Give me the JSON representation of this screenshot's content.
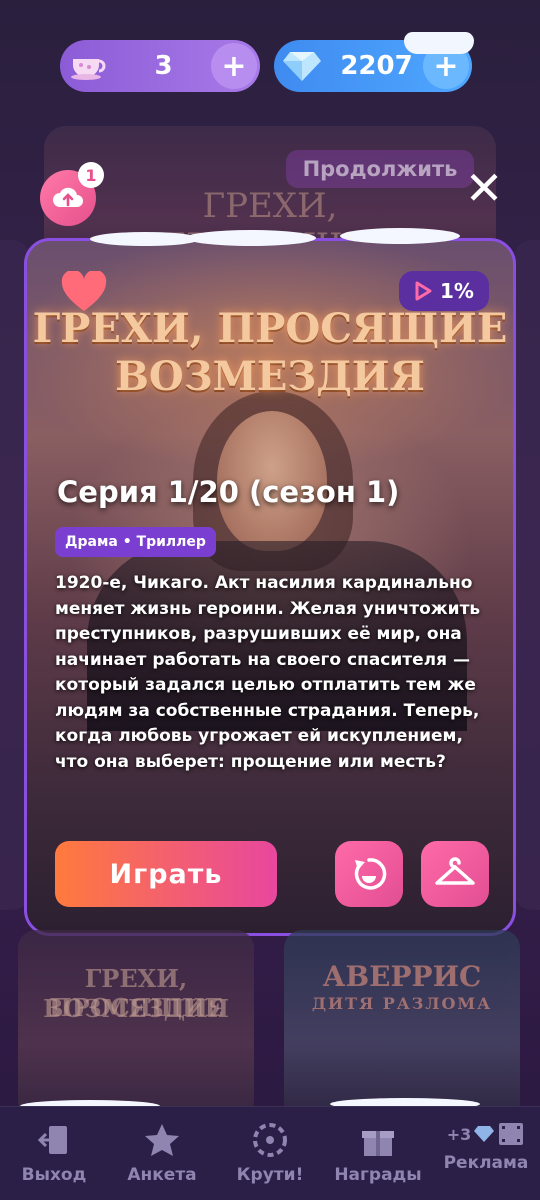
{
  "currency": {
    "tea_count": "3",
    "gems_count": "2207",
    "plus_symbol": "+"
  },
  "background": {
    "continue_label": "Продолжить",
    "ghost_title": "ГРЕХИ, ПРОСЯЩИЕ"
  },
  "upload": {
    "badge_count": "1"
  },
  "card": {
    "art_title_line1": "ГРЕХИ, ПРОСЯЩИЕ",
    "art_title_line2": "ВОЗМЕЗДИЯ",
    "progress_label": "1%",
    "episode_title": "Серия 1/20 (сезон 1)",
    "genres": "Драма • Триллер",
    "description": "1920-е, Чикаго. Акт насилия кардинально меняет жизнь героини. Желая уничтожить преступников, разрушивших её мир, она начинает работать на своего спасителя — который задался целью отплатить тем же людям за собственные страдания. Теперь, когда любовь угрожает ей искуплением, что она выберет: прощение или месть?",
    "play_label": "Играть"
  },
  "lower_cards": {
    "left_title_line1": "ГРЕХИ, ПРОСЯЩИЕ",
    "left_title_line2": "ВОЗМЕЗДИЯ",
    "right_title_line1": "АВЕРРИС",
    "right_title_line2": "ДИТЯ РАЗЛОМА"
  },
  "nav": {
    "items": [
      {
        "label": "Выход",
        "icon": "exit-door-icon"
      },
      {
        "label": "Анкета",
        "icon": "star-profile-icon"
      },
      {
        "label": "Крути!",
        "icon": "wheel-icon"
      },
      {
        "label": "Награды",
        "icon": "gift-icon"
      },
      {
        "label": "Реклама",
        "icon": "video-ad-icon"
      }
    ],
    "ad_bonus": "+3"
  },
  "colors": {
    "accent_purple": "#8a4fe0",
    "play_gradient_start": "#ff7a3d",
    "play_gradient_end": "#e8479e",
    "gem_blue": "#4fa7ff"
  }
}
